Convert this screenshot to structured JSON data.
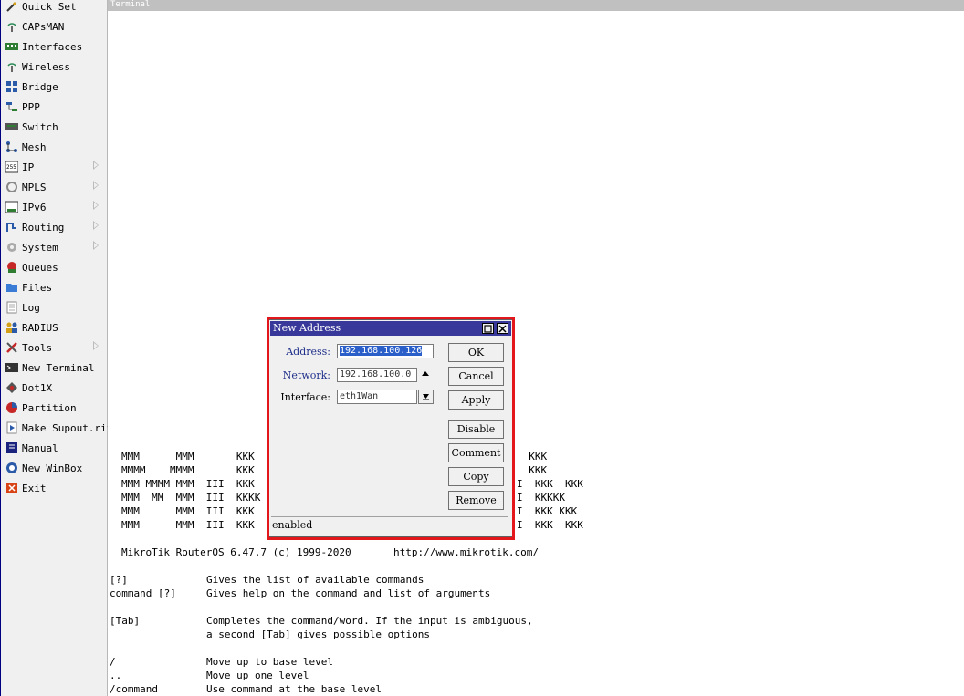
{
  "sidebar": {
    "items": [
      {
        "label": "Quick Set",
        "icon": "wand-icon",
        "submenu": false
      },
      {
        "label": "CAPsMAN",
        "icon": "antenna-icon",
        "submenu": false
      },
      {
        "label": "Interfaces",
        "icon": "interfaces-icon",
        "submenu": false
      },
      {
        "label": "Wireless",
        "icon": "wireless-icon",
        "submenu": false
      },
      {
        "label": "Bridge",
        "icon": "bridge-icon",
        "submenu": false
      },
      {
        "label": "PPP",
        "icon": "ppp-icon",
        "submenu": false
      },
      {
        "label": "Switch",
        "icon": "switch-icon",
        "submenu": false
      },
      {
        "label": "Mesh",
        "icon": "mesh-icon",
        "submenu": false
      },
      {
        "label": "IP",
        "icon": "ip-icon",
        "submenu": true
      },
      {
        "label": "MPLS",
        "icon": "mpls-icon",
        "submenu": true
      },
      {
        "label": "IPv6",
        "icon": "ipv6-icon",
        "submenu": true
      },
      {
        "label": "Routing",
        "icon": "routing-icon",
        "submenu": true
      },
      {
        "label": "System",
        "icon": "gear-icon",
        "submenu": true
      },
      {
        "label": "Queues",
        "icon": "queues-icon",
        "submenu": false
      },
      {
        "label": "Files",
        "icon": "folder-icon",
        "submenu": false
      },
      {
        "label": "Log",
        "icon": "log-icon",
        "submenu": false
      },
      {
        "label": "RADIUS",
        "icon": "users-icon",
        "submenu": false
      },
      {
        "label": "Tools",
        "icon": "tools-icon",
        "submenu": true
      },
      {
        "label": "New Terminal",
        "icon": "terminal-icon",
        "submenu": false
      },
      {
        "label": "Dot1X",
        "icon": "dot1x-icon",
        "submenu": false
      },
      {
        "label": "Partition",
        "icon": "partition-icon",
        "submenu": false
      },
      {
        "label": "Make Supout.rif",
        "icon": "supout-icon",
        "submenu": false
      },
      {
        "label": "Manual",
        "icon": "manual-icon",
        "submenu": false
      },
      {
        "label": "New WinBox",
        "icon": "winbox-icon",
        "submenu": false
      },
      {
        "label": "Exit",
        "icon": "exit-icon",
        "submenu": false
      }
    ]
  },
  "terminal": {
    "title": "Terminal",
    "banner_lines": [
      "MMM      MMM       KKK",
      "MMMM    MMMM       KKK",
      "MMM MMMM MMM  III  KKK",
      "MMM  MM  MMM  III  KKKK",
      "MMM      MMM  III  KKK",
      "MMM      MMM  III  KKK"
    ],
    "banner_right_lines": [
      "  KKK",
      "  KKK",
      "I  KKK  KKK",
      "I  KKKKK",
      "I  KKK KKK",
      "I  KKK  KKK"
    ],
    "version_line": "MikroTik RouterOS 6.47.7 (c) 1999-2020       http://www.mikrotik.com/",
    "help_lines": [
      "[?]             Gives the list of available commands",
      "command [?]     Gives help on the command and list of arguments",
      "",
      "[Tab]           Completes the command/word. If the input is ambiguous,",
      "                a second [Tab] gives possible options",
      "",
      "/               Move up to base level",
      "..              Move up one level",
      "/command        Use command at the base level"
    ]
  },
  "dialog": {
    "title": "New Address",
    "address_label": "Address:",
    "address_value": "192.168.100.126",
    "network_label": "Network:",
    "network_value": "192.168.100.0",
    "interface_label": "Interface:",
    "interface_value": "eth1Wan",
    "buttons": {
      "ok": "OK",
      "cancel": "Cancel",
      "apply": "Apply",
      "disable": "Disable",
      "comment": "Comment",
      "copy": "Copy",
      "remove": "Remove"
    },
    "status": "enabled"
  },
  "colors": {
    "dialog_title_bg": "#38389a",
    "highlight_border": "#e3161b",
    "label_blue": "#1f2f8a",
    "selection": "#2a5fc9"
  }
}
